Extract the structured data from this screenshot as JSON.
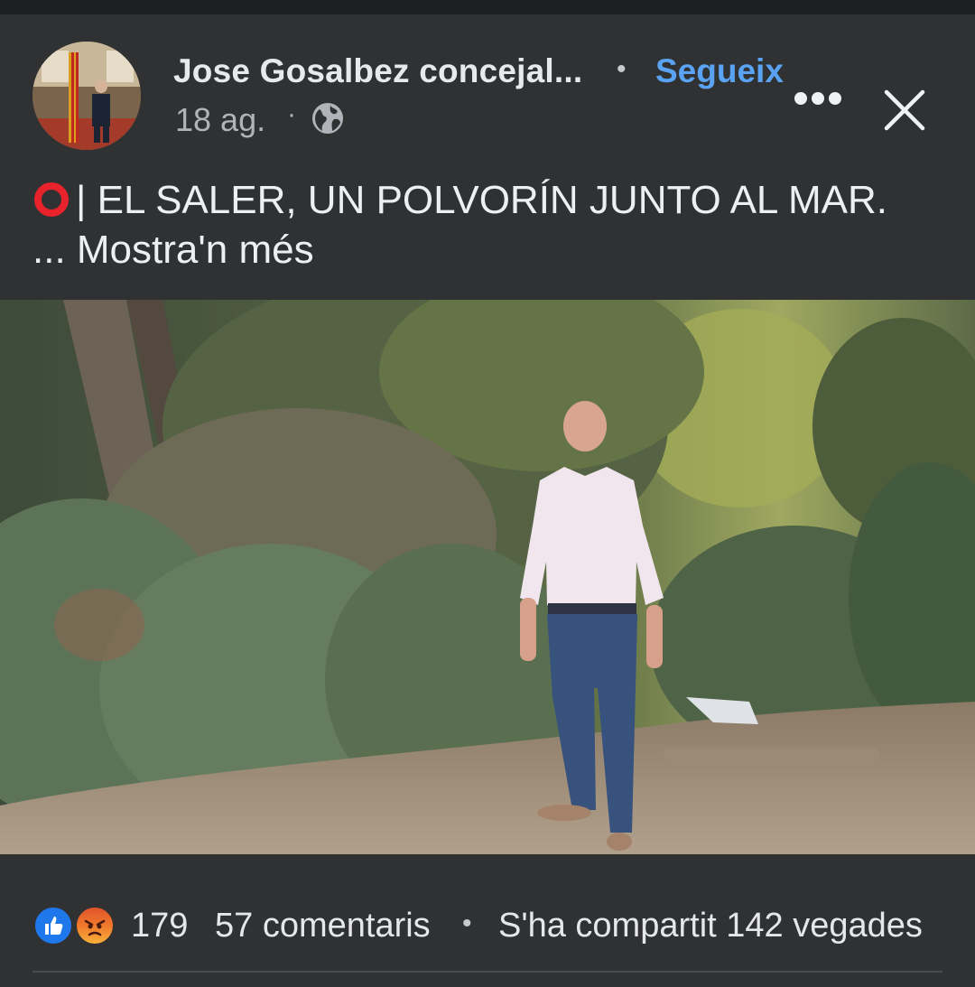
{
  "post": {
    "author_name": "Jose Gosalbez concejal...",
    "follow_label": "Segueix",
    "date": "18 ag.",
    "separator": "·",
    "privacy_icon": "globe-icon",
    "more_icon": "more-options-icon",
    "close_icon": "close-icon",
    "caption": "| EL SALER, UN POLVORÍN JUNTO AL MAR.",
    "caption_emoji": "red-circle-icon",
    "see_more": "... Mostra'n més"
  },
  "footer": {
    "reaction_icons": [
      "like-icon",
      "angry-icon"
    ],
    "reaction_count": "179",
    "comments": "57 comentaris",
    "separator": "•",
    "shares": "S'ha compartit 142 vegades"
  },
  "colors": {
    "background": "#303133",
    "link": "#5aa2f2",
    "like": "#1f77ec",
    "angry": "#f0782c"
  }
}
